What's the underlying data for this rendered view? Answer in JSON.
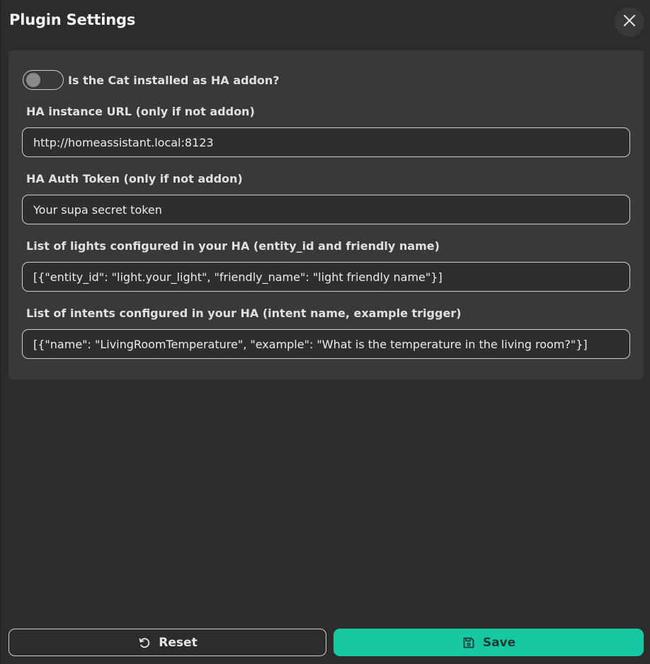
{
  "header": {
    "title": "Plugin Settings"
  },
  "toggle": {
    "label": "Is the Cat installed as HA addon?",
    "checked": false
  },
  "fields": [
    {
      "label": "HA instance URL (only if not addon)",
      "value": "http://homeassistant.local:8123"
    },
    {
      "label": "HA Auth Token (only if not addon)",
      "value": "Your supa secret token"
    },
    {
      "label": "List of lights configured in your HA (entity_id and friendly name)",
      "value": "[{\"entity_id\": \"light.your_light\", \"friendly_name\": \"light friendly name\"}]"
    },
    {
      "label": "List of intents configured in your HA (intent name, example trigger)",
      "value": "[{\"name\": \"LivingRoomTemperature\", \"example\": \"What is the temperature in the living room?\"}]"
    }
  ],
  "footer": {
    "reset_label": "Reset",
    "save_label": "Save"
  },
  "colors": {
    "background": "#2c2c2c",
    "panel": "#393939",
    "accent": "#17c9a2"
  },
  "icons": {
    "close": "close-icon",
    "reset": "reset-icon",
    "save": "save-icon"
  }
}
